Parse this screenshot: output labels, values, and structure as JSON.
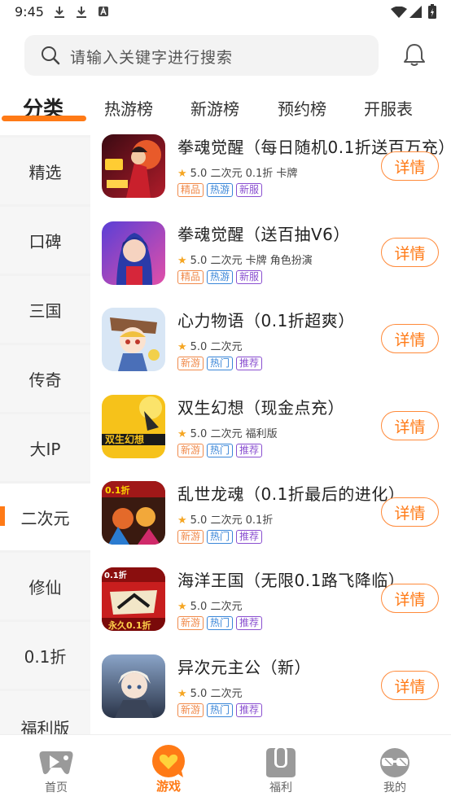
{
  "status_bar": {
    "time": "9:45"
  },
  "search": {
    "placeholder": "请输入关键字进行搜索"
  },
  "tabs": [
    "分类",
    "热游榜",
    "新游榜",
    "预约榜",
    "开服表"
  ],
  "sidebar": {
    "items": [
      "精选",
      "口碑",
      "三国",
      "传奇",
      "大IP",
      "二次元",
      "修仙",
      "0.1折",
      "福利版"
    ],
    "active_index": 5
  },
  "games": [
    {
      "name": "拳魂觉醒（每日随机0.1折送百万充）",
      "rating": "5.0",
      "meta": "二次元 0.1折 卡牌",
      "tags": [
        {
          "label": "精品",
          "color": "orange"
        },
        {
          "label": "热游",
          "color": "blue"
        },
        {
          "label": "新服",
          "color": "purple"
        }
      ]
    },
    {
      "name": "拳魂觉醒（送百抽V6）",
      "rating": "5.0",
      "meta": "二次元 卡牌 角色扮演",
      "tags": [
        {
          "label": "精品",
          "color": "orange"
        },
        {
          "label": "热游",
          "color": "blue"
        },
        {
          "label": "新服",
          "color": "purple"
        }
      ]
    },
    {
      "name": "心力物语（0.1折超爽）",
      "rating": "5.0",
      "meta": "二次元",
      "tags": [
        {
          "label": "新游",
          "color": "orange"
        },
        {
          "label": "热门",
          "color": "blue"
        },
        {
          "label": "推荐",
          "color": "purple"
        }
      ]
    },
    {
      "name": "双生幻想（现金点充）",
      "rating": "5.0",
      "meta": "二次元 福利版",
      "tags": [
        {
          "label": "新游",
          "color": "orange"
        },
        {
          "label": "热门",
          "color": "blue"
        },
        {
          "label": "推荐",
          "color": "purple"
        }
      ]
    },
    {
      "name": "乱世龙魂（0.1折最后的进化）",
      "rating": "5.0",
      "meta": "二次元 0.1折",
      "tags": [
        {
          "label": "新游",
          "color": "orange"
        },
        {
          "label": "热门",
          "color": "blue"
        },
        {
          "label": "推荐",
          "color": "purple"
        }
      ]
    },
    {
      "name": "海洋王国（无限0.1路飞降临）",
      "rating": "5.0",
      "meta": "二次元",
      "tags": [
        {
          "label": "新游",
          "color": "orange"
        },
        {
          "label": "热门",
          "color": "blue"
        },
        {
          "label": "推荐",
          "color": "purple"
        }
      ]
    },
    {
      "name": "异次元主公（新）",
      "rating": "5.0",
      "meta": "二次元",
      "tags": [
        {
          "label": "新游",
          "color": "orange"
        },
        {
          "label": "热门",
          "color": "blue"
        },
        {
          "label": "推荐",
          "color": "purple"
        }
      ]
    }
  ],
  "detail_label": "详情",
  "bottom_nav": {
    "items": [
      "首页",
      "游戏",
      "福利",
      "我的"
    ],
    "active_index": 1
  },
  "colors": {
    "accent": "#ff7a16",
    "tag_orange": "#f08a4b",
    "tag_blue": "#3a86d8",
    "tag_purple": "#8a4fd0"
  }
}
